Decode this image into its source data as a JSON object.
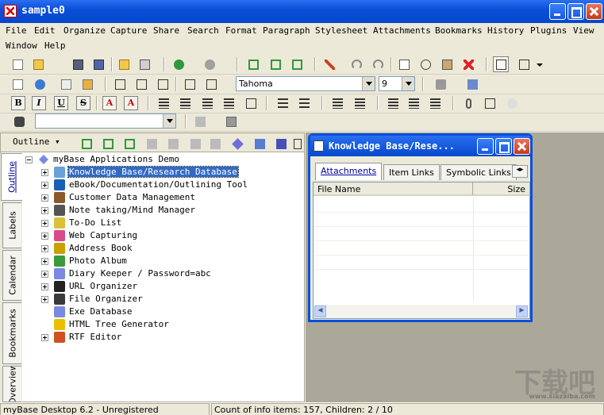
{
  "window": {
    "title": "sample0"
  },
  "menu": [
    "File",
    "Edit",
    "Organize",
    "Capture",
    "Share",
    "Search",
    "Format",
    "Paragraph",
    "Stylesheet",
    "Attachments",
    "Bookmarks",
    "History",
    "Plugins",
    "View",
    "Window",
    "Help"
  ],
  "format_bar": {
    "font_name": "Tahoma",
    "font_size": "9",
    "bold": "B",
    "italic": "I",
    "underline": "U",
    "strike": "S"
  },
  "find_bar": {
    "search_value": ""
  },
  "outline_bar": {
    "mode_label": "Outline"
  },
  "side_tabs": [
    "Outline",
    "Labels",
    "Calendar",
    "Bookmarks",
    "Overview"
  ],
  "tree": {
    "root": "myBase Applications Demo",
    "items": [
      {
        "label": "Knowledge Base/Research Database",
        "icon": "home-icon",
        "selected": true,
        "expandable": true
      },
      {
        "label": "eBook/Documentation/Outlining Tool",
        "icon": "ebook-icon",
        "selected": false,
        "expandable": true
      },
      {
        "label": "Customer Data Management",
        "icon": "contacts-icon",
        "selected": false,
        "expandable": true
      },
      {
        "label": "Note taking/Mind Manager",
        "icon": "notepad-icon",
        "selected": false,
        "expandable": true
      },
      {
        "label": "To-Do List",
        "icon": "checklist-icon",
        "selected": false,
        "expandable": true
      },
      {
        "label": "Web Capturing",
        "icon": "butterfly-icon",
        "selected": false,
        "expandable": true
      },
      {
        "label": "Address Book",
        "icon": "lock-icon",
        "selected": false,
        "expandable": true
      },
      {
        "label": "Photo Album",
        "icon": "photo-icon",
        "selected": false,
        "expandable": true
      },
      {
        "label": "Diary Keeper / Password=abc",
        "icon": "gem-icon",
        "selected": false,
        "expandable": true
      },
      {
        "label": "URL Organizer",
        "icon": "house-icon",
        "selected": false,
        "expandable": true
      },
      {
        "label": "File Organizer",
        "icon": "floppy-icon",
        "selected": false,
        "expandable": true
      },
      {
        "label": "Exe Database",
        "icon": "gem-icon",
        "selected": false,
        "expandable": false
      },
      {
        "label": "HTML Tree Generator",
        "icon": "plus-icon",
        "selected": false,
        "expandable": false
      },
      {
        "label": "RTF Editor",
        "icon": "pencil-icon",
        "selected": false,
        "expandable": true
      }
    ]
  },
  "kb_window": {
    "title": "Knowledge Base/Rese...",
    "tabs": [
      "Attachments",
      "Item Links",
      "Symbolic Links"
    ],
    "columns": [
      "File Name",
      "Size"
    ]
  },
  "status": {
    "left": "myBase Desktop 6.2 - Unregistered",
    "right": "Count of info items: 157, Children: 2 / 10"
  },
  "watermark": {
    "text": "下载吧",
    "url": "www.xiazaiba.com"
  }
}
